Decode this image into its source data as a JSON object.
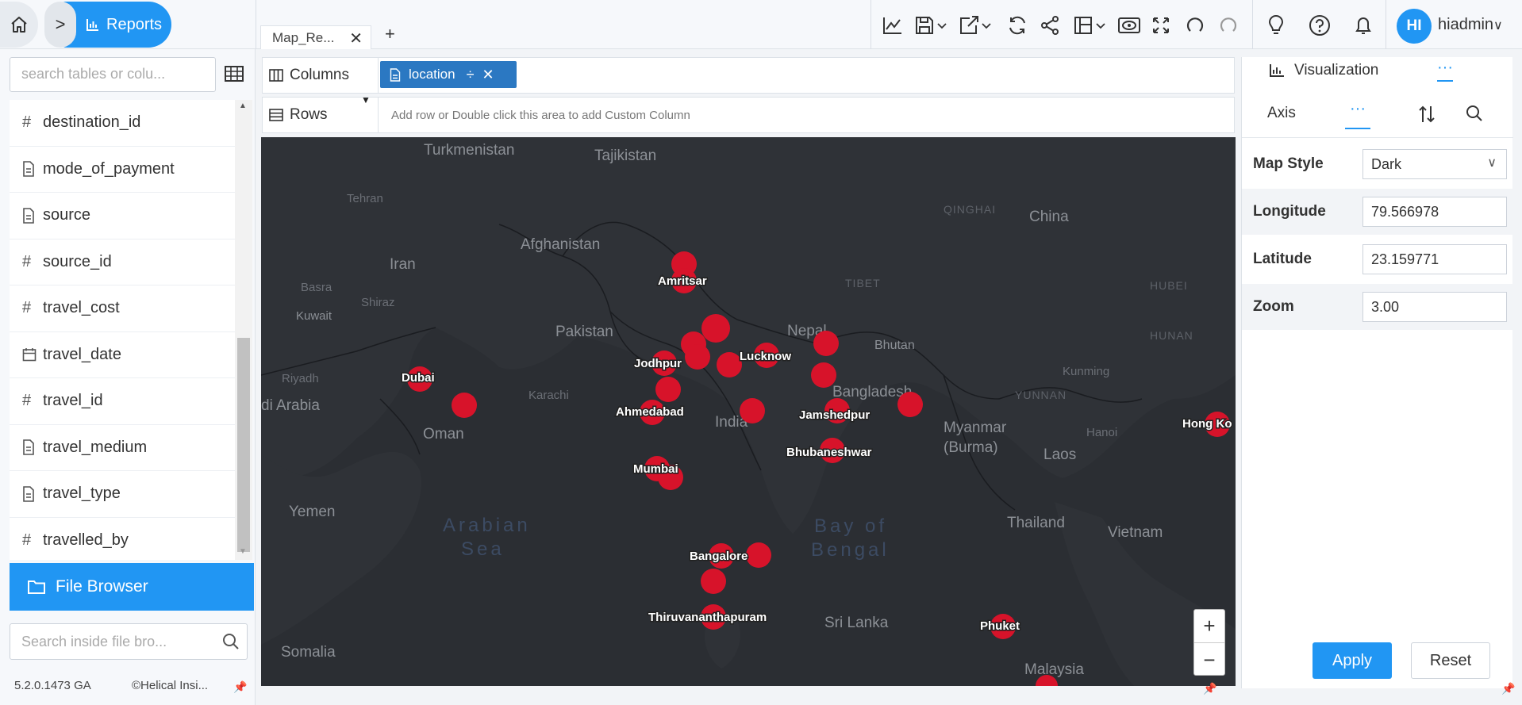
{
  "breadcrumb": {
    "home_icon": "home-icon",
    "chevron": ">",
    "current": "Reports"
  },
  "tabs": [
    {
      "label": "Map_Re...",
      "close": "✕"
    }
  ],
  "tab_add": "+",
  "user": {
    "initials": "HI",
    "name": "hiadmin"
  },
  "field_search": {
    "placeholder": "search tables or colu..."
  },
  "fields": [
    {
      "type": "number",
      "name": "destination_id"
    },
    {
      "type": "text",
      "name": "mode_of_payment"
    },
    {
      "type": "text",
      "name": "source"
    },
    {
      "type": "number",
      "name": "source_id"
    },
    {
      "type": "number",
      "name": "travel_cost"
    },
    {
      "type": "date",
      "name": "travel_date"
    },
    {
      "type": "number",
      "name": "travel_id"
    },
    {
      "type": "text",
      "name": "travel_medium"
    },
    {
      "type": "text",
      "name": "travel_type"
    },
    {
      "type": "number",
      "name": "travelled_by"
    }
  ],
  "file_browser": {
    "label": "File Browser",
    "search_placeholder": "Search inside file bro..."
  },
  "footer": {
    "version": "5.2.0.1473 GA",
    "copyright": "©Helical Insi..."
  },
  "shelves": {
    "columns_label": "Columns",
    "columns_pill": "location",
    "rows_label": "Rows",
    "rows_hint": "Add row or Double click this area to add Custom Column"
  },
  "map": {
    "zoom_in": "+",
    "zoom_out": "−",
    "labels": {
      "turkmenistan": "Turkmenistan",
      "tajikistan": "Tajikistan",
      "afghanistan": "Afghanistan",
      "iran": "Iran",
      "pakistan": "Pakistan",
      "kuwait": "Kuwait",
      "arabia": "di Arabia",
      "oman": "Oman",
      "yemen": "Yemen",
      "somalia": "Somalia",
      "nepal": "Nepal",
      "bhutan": "Bhutan",
      "bangladesh": "Bangladesh",
      "india": "India",
      "myanmar": "Myanmar",
      "burma": "(Burma)",
      "china": "China",
      "laos": "Laos",
      "thailand": "Thailand",
      "vietnam": "Vietnam",
      "malaysia": "Malaysia",
      "arabian_sea_1": "Arabian",
      "arabian_sea_2": "Sea",
      "bay_1": "Bay of",
      "bay_2": "Bengal",
      "srilanka": "Sri Lanka",
      "tibet": "TIBET",
      "qinghai": "QINGHAI",
      "hubei": "HUBEI",
      "hunan": "HUNAN",
      "yunnan": "YUNNAN",
      "tehran": "Tehran",
      "shiraz": "Shiraz",
      "basra": "Basra",
      "riyadh": "Riyadh",
      "karachi": "Karachi",
      "hanoi": "Hanoi",
      "kunming": "Kunming"
    },
    "cities": [
      {
        "name": "Amritsar"
      },
      {
        "name": "Jodhpur"
      },
      {
        "name": "Lucknow"
      },
      {
        "name": "Ahmedabad"
      },
      {
        "name": "Jamshedpur"
      },
      {
        "name": "Bhubaneshwar"
      },
      {
        "name": "Mumbai"
      },
      {
        "name": "Bangalore"
      },
      {
        "name": "Thiruvananthapuram"
      },
      {
        "name": "Dubai"
      },
      {
        "name": "Phuket"
      },
      {
        "name": "Hong Ko"
      }
    ],
    "marker_color": "#d7132a",
    "background_color": "#25282d"
  },
  "right_panel": {
    "title": "Visualization",
    "more": "···",
    "tab_axis": "Axis",
    "tab_more": "···",
    "map_style_label": "Map Style",
    "map_style_value": "Dark",
    "longitude_label": "Longitude",
    "longitude_value": "79.566978",
    "latitude_label": "Latitude",
    "latitude_value": "23.159771",
    "zoom_label": "Zoom",
    "zoom_value": "3.00",
    "apply": "Apply",
    "reset": "Reset"
  },
  "accent_color": "#2196f3"
}
